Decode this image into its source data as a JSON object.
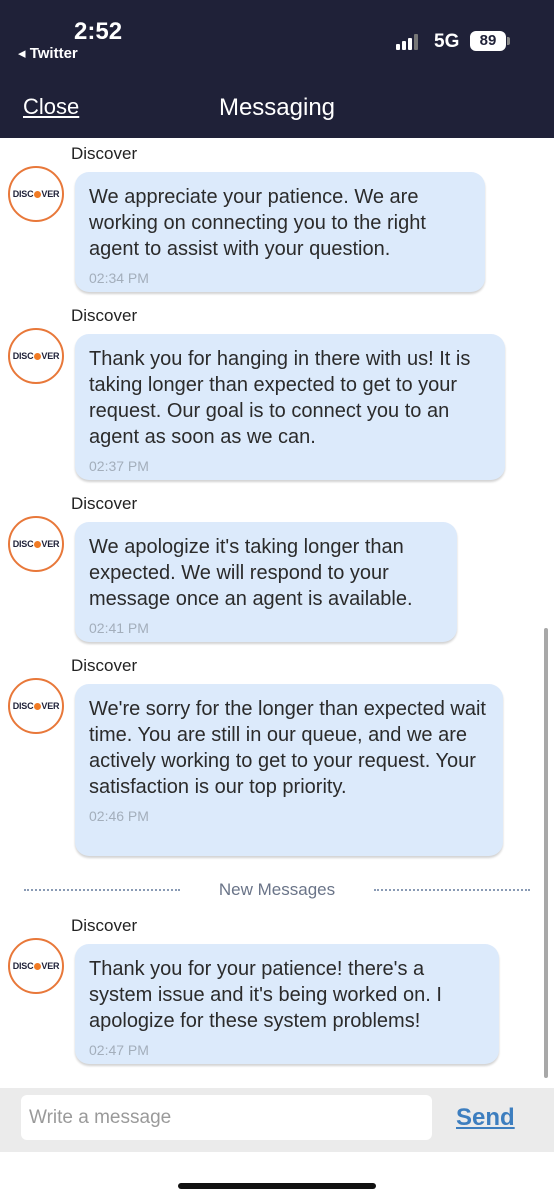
{
  "status_bar": {
    "time": "2:52",
    "back_app": "◂ Twitter",
    "network": "5G",
    "battery": "89"
  },
  "header": {
    "close_label": "Close",
    "title": "Messaging"
  },
  "messages": [
    {
      "sender": "Discover",
      "text": "We appreciate your patience. We are working on connecting you to the right agent to assist with your question.",
      "time": "02:34 PM"
    },
    {
      "sender": "Discover",
      "text": "Thank you for hanging in there with us! It is taking longer than expected to get to your request. Our goal is to connect you to an agent as soon as we can.",
      "time": "02:37 PM"
    },
    {
      "sender": "Discover",
      "text": "We apologize it's taking longer than expected. We will respond to your message once an agent is available.",
      "time": "02:41 PM"
    },
    {
      "sender": "Discover",
      "text": "We're sorry for the longer than expected wait time. You are still in our queue, and we are actively working to get to your request. Your satisfaction is our top priority.",
      "time": "02:46 PM"
    },
    {
      "sender": "Discover",
      "text": "Thank you for your patience! there's a system issue and it's being worked on. I apologize for these system problems!",
      "time": "02:47 PM"
    }
  ],
  "avatar_logo": {
    "left": "DISC",
    "right": "VER"
  },
  "divider": {
    "label": "New Messages"
  },
  "composer": {
    "placeholder": "Write a message",
    "send_label": "Send"
  },
  "colors": {
    "header_bg": "#1f2138",
    "bubble_bg": "#dceafb",
    "avatar_ring": "#e8783a",
    "send_link": "#3d7ebf"
  }
}
